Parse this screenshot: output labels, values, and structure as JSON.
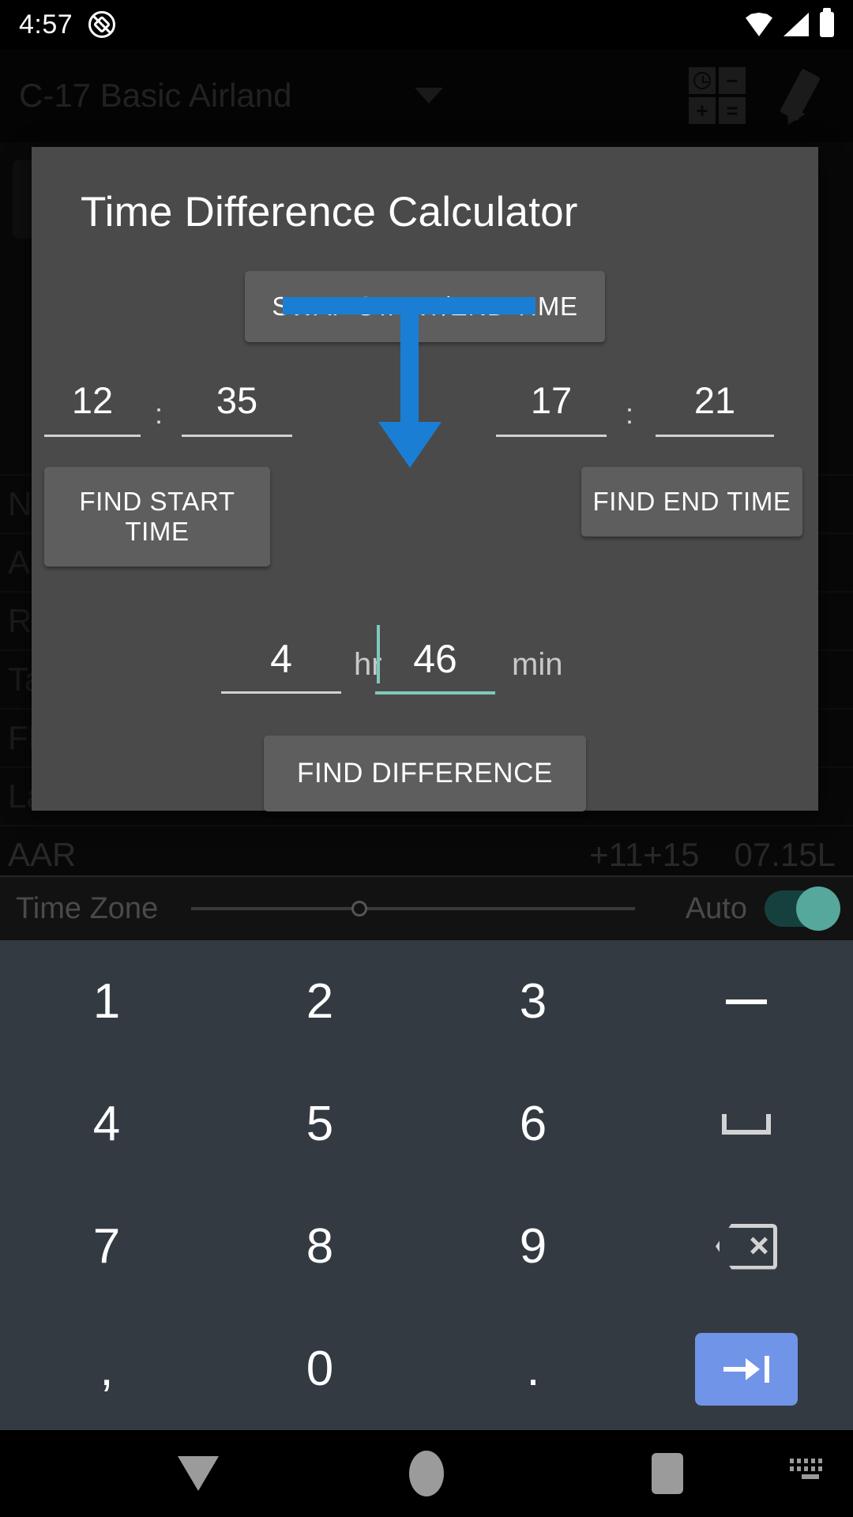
{
  "status_bar": {
    "time": "4:57",
    "icons": [
      "mute-icon",
      "wifi-icon",
      "signal-icon",
      "battery-icon"
    ]
  },
  "app_bar": {
    "title": "C-17 Basic Airland",
    "dropdown_icon": "chevron-down-icon",
    "time_calc_icon": "time-calculator-icon",
    "edit_icon": "pencil-icon",
    "calc_glyphs": [
      "clock",
      "−",
      "+",
      "="
    ]
  },
  "background": {
    "top_label": "L",
    "rows": [
      {
        "label": "No",
        "v1": "",
        "v2": ""
      },
      {
        "label": "AI",
        "v1": "",
        "v2": ""
      },
      {
        "label": "Re",
        "v1": "",
        "v2": ""
      },
      {
        "label": "Ta",
        "v1": "",
        "v2": ""
      },
      {
        "label": "FL",
        "v1": "",
        "v2": ""
      },
      {
        "label": "La",
        "v1": "",
        "v2": ""
      },
      {
        "label": "AAR",
        "v1": "+11+15",
        "v2": "07.15L"
      }
    ]
  },
  "time_zone_bar": {
    "label": "Time Zone",
    "auto_label": "Auto",
    "auto_on": true,
    "slider_value": "0"
  },
  "dialog": {
    "title": "Time Difference Calculator",
    "swap_button": "SWAP START/END TIME",
    "start_time": {
      "hours": "12",
      "minutes": "35",
      "separator": ":"
    },
    "end_time": {
      "hours": "17",
      "minutes": "21",
      "separator": ":"
    },
    "find_start_button": "FIND START TIME",
    "find_end_button": "FIND END TIME",
    "arrow_icon": "down-arrow-icon",
    "arrow_color": "#1a7fd4",
    "difference": {
      "hours": "4",
      "hours_unit": "hr",
      "minutes": "46",
      "minutes_unit": "min",
      "focused_field": "minutes",
      "focus_color": "#80c8bc"
    },
    "find_difference_button": "FIND DIFFERENCE"
  },
  "keypad": {
    "keys": [
      {
        "label": "1",
        "name": "key-1",
        "type": "text"
      },
      {
        "label": "2",
        "name": "key-2",
        "type": "text"
      },
      {
        "label": "3",
        "name": "key-3",
        "type": "text"
      },
      {
        "label": "−",
        "name": "key-minus",
        "type": "glyph-minus"
      },
      {
        "label": "4",
        "name": "key-4",
        "type": "text"
      },
      {
        "label": "5",
        "name": "key-5",
        "type": "text"
      },
      {
        "label": "6",
        "name": "key-6",
        "type": "text"
      },
      {
        "label": "",
        "name": "key-space",
        "type": "glyph-space"
      },
      {
        "label": "7",
        "name": "key-7",
        "type": "text"
      },
      {
        "label": "8",
        "name": "key-8",
        "type": "text"
      },
      {
        "label": "9",
        "name": "key-9",
        "type": "text"
      },
      {
        "label": "",
        "name": "key-backspace",
        "type": "glyph-backspace"
      },
      {
        "label": ",",
        "name": "key-comma",
        "type": "text"
      },
      {
        "label": "0",
        "name": "key-0",
        "type": "text"
      },
      {
        "label": ".",
        "name": "key-period",
        "type": "text"
      },
      {
        "label": "",
        "name": "key-enter",
        "type": "glyph-enter"
      }
    ],
    "enter_color": "#7094e8"
  },
  "nav_bar": {
    "back_icon": "collapse-keyboard-icon",
    "home_icon": "home-icon",
    "recents_icon": "recents-icon",
    "keyboard_icon": "keyboard-switch-icon"
  }
}
